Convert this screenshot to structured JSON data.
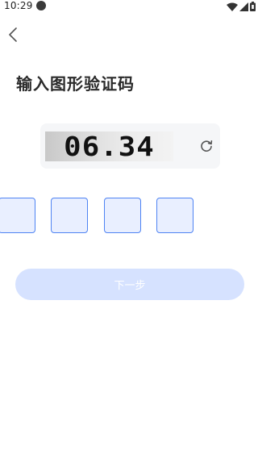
{
  "status_bar": {
    "time": "10:29"
  },
  "page": {
    "title": "输入图形验证码",
    "captcha_text": "06.34"
  },
  "code_inputs": [
    "",
    "",
    "",
    ""
  ],
  "actions": {
    "next_label": "下一步"
  },
  "colors": {
    "accent": "#4e83f3",
    "input_fill": "#e9efff",
    "button_disabled": "#d6e2ff",
    "captcha_bg": "#f5f6f8"
  },
  "icons": {
    "back": "chevron-left-icon",
    "refresh": "refresh-icon",
    "wifi": "wifi-icon",
    "signal": "signal-icon",
    "battery": "battery-icon"
  }
}
